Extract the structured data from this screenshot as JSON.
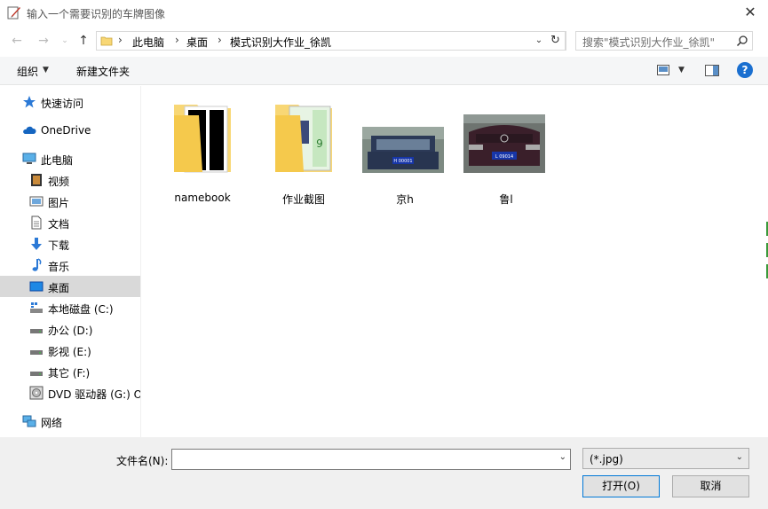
{
  "window": {
    "title": "输入一个需要识别的车牌图像"
  },
  "address": {
    "crumbs": [
      "此电脑",
      "桌面",
      "模式识别大作业_徐凯"
    ]
  },
  "search": {
    "placeholder": "搜索\"模式识别大作业_徐凯\""
  },
  "toolbar": {
    "organize": "组织",
    "new_folder": "新建文件夹"
  },
  "sidebar": {
    "items": [
      {
        "label": "快速访问",
        "icon": "star-icon"
      },
      {
        "label": "OneDrive",
        "icon": "cloud-icon"
      },
      {
        "label": "此电脑",
        "icon": "computer-icon"
      },
      {
        "label": "视频",
        "icon": "video-icon"
      },
      {
        "label": "图片",
        "icon": "picture-icon"
      },
      {
        "label": "文档",
        "icon": "document-icon"
      },
      {
        "label": "下载",
        "icon": "download-icon"
      },
      {
        "label": "音乐",
        "icon": "music-icon"
      },
      {
        "label": "桌面",
        "icon": "desktop-icon",
        "selected": true
      },
      {
        "label": "本地磁盘 (C:)",
        "icon": "drive-icon"
      },
      {
        "label": "办公 (D:)",
        "icon": "drive-icon"
      },
      {
        "label": "影视 (E:)",
        "icon": "drive-icon"
      },
      {
        "label": "其它 (F:)",
        "icon": "drive-icon"
      },
      {
        "label": "DVD 驱动器 (G:) O",
        "icon": "dvd-icon"
      },
      {
        "label": "网络",
        "icon": "network-icon"
      }
    ]
  },
  "files": [
    {
      "label": "namebook",
      "type": "folder"
    },
    {
      "label": "作业截图",
      "type": "folder"
    },
    {
      "label": "京h",
      "type": "image",
      "plate": "H 00001"
    },
    {
      "label": "鲁l",
      "type": "image",
      "plate": "L 09014"
    }
  ],
  "bottom": {
    "filename_label": "文件名(N):",
    "filename_value": "",
    "filetype": "(*.jpg)",
    "open_button": "打开(O)",
    "cancel_button": "取消"
  },
  "colors": {
    "accent": "#0078d7",
    "selected": "#d9d9d9",
    "folder": "#f8d775"
  }
}
